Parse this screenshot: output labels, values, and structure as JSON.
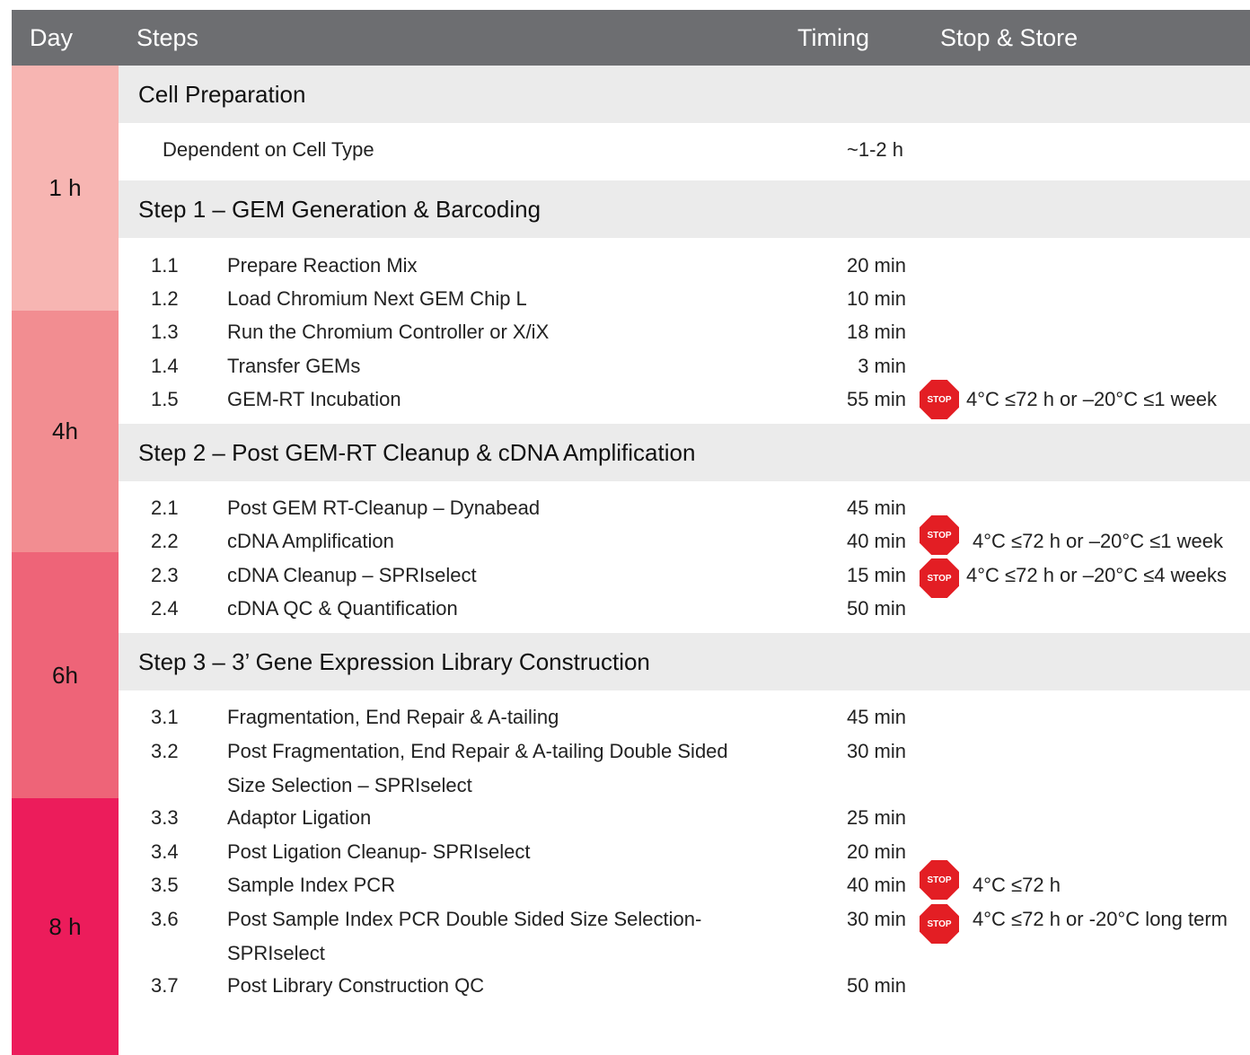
{
  "header": {
    "day": "Day",
    "steps": "Steps",
    "timing": "Timing",
    "stop_store": "Stop & Store"
  },
  "days": [
    {
      "label": "1 h",
      "color": "#f7b5b2"
    },
    {
      "label": "4h",
      "color": "#f28d91"
    },
    {
      "label": "6h",
      "color": "#ee6478"
    },
    {
      "label": "8 h",
      "color": "#ec1c5b"
    }
  ],
  "sections": {
    "cell_prep": {
      "title": "Cell Preparation",
      "row": {
        "name": "Dependent on Cell Type",
        "time": "~1-2 h"
      }
    },
    "step1": {
      "title": "Step 1 – GEM Generation & Barcoding",
      "rows": [
        {
          "num": "1.1",
          "name": "Prepare Reaction Mix",
          "time": "20 min"
        },
        {
          "num": "1.2",
          "name": "Load Chromium Next GEM Chip L",
          "time": "10 min"
        },
        {
          "num": "1.3",
          "name": "Run the Chromium Controller or X/iX",
          "time": "18 min"
        },
        {
          "num": "1.4",
          "name": "Transfer GEMs",
          "time": "3 min"
        },
        {
          "num": "1.5",
          "name": "GEM-RT Incubation",
          "time": "55 min",
          "store": "4°C ≤72 h or –20°C ≤1 week"
        }
      ]
    },
    "step2": {
      "title": "Step 2 – Post GEM-RT Cleanup & cDNA Amplification",
      "rows": [
        {
          "num": "2.1",
          "name": "Post GEM RT-Cleanup – Dynabead",
          "time": "45 min"
        },
        {
          "num": "2.2",
          "name": "cDNA Amplification",
          "time": "40 min",
          "store": "4°C ≤72 h or –20°C ≤1 week"
        },
        {
          "num": "2.3",
          "name": "cDNA Cleanup – SPRIselect",
          "time": "15 min",
          "store": "4°C ≤72 h or –20°C ≤4 weeks"
        },
        {
          "num": "2.4",
          "name": "cDNA QC & Quantification",
          "time": "50 min"
        }
      ]
    },
    "step3": {
      "title": "Step 3 – 3’ Gene Expression Library Construction",
      "rows": [
        {
          "num": "3.1",
          "name": "Fragmentation, End Repair & A-tailing",
          "time": "45 min"
        },
        {
          "num": "3.2",
          "name": "Post Fragmentation, End Repair & A-tailing Double Sided Size Selection – SPRIselect",
          "time": "30 min"
        },
        {
          "num": "3.3",
          "name": "Adaptor Ligation",
          "time": "25 min"
        },
        {
          "num": "3.4",
          "name": "Post Ligation Cleanup- SPRIselect",
          "time": "20 min"
        },
        {
          "num": "3.5",
          "name": "Sample Index PCR",
          "time": "40 min",
          "store": "4°C ≤72 h"
        },
        {
          "num": "3.6",
          "name": "Post Sample Index PCR Double Sided Size Selection- SPRIselect",
          "time": "30 min",
          "store": "4°C ≤72 h or -20°C long term"
        },
        {
          "num": "3.7",
          "name": "Post Library Construction QC",
          "time": "50  min"
        }
      ]
    }
  },
  "stop_sign": {
    "label": "STOP",
    "color": "#e31e24"
  }
}
